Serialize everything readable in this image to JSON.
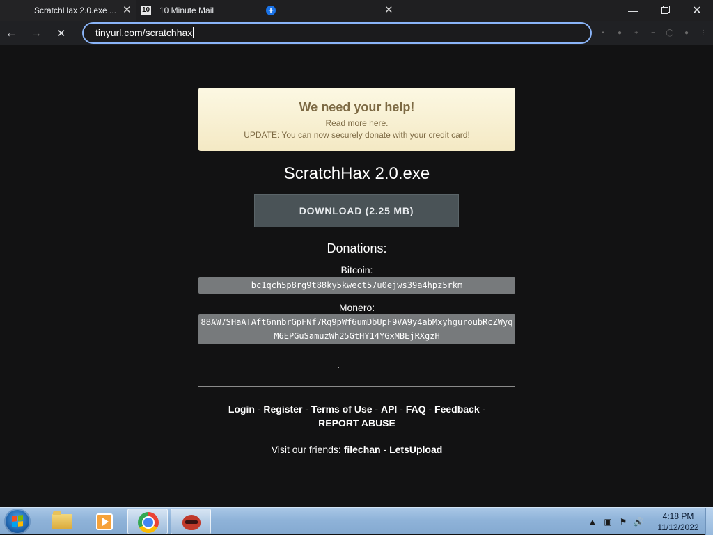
{
  "browser": {
    "tabs": [
      {
        "title": "ScratchHax 2.0.exe ...",
        "close": "✕",
        "active": true
      },
      {
        "title": "10 Minute Mail",
        "favicon_text": "10",
        "close": "✕",
        "active": false
      }
    ],
    "new_tab": "+",
    "window_controls": {
      "minimize": "—",
      "close": "✕"
    },
    "nav": {
      "back": "←",
      "forward": "→",
      "stop": "✕"
    },
    "address": "tinyurl.com/scratchhax",
    "toolbar_icons": [
      "▪",
      "●",
      "+",
      "−",
      "◯",
      "●",
      "⋮"
    ]
  },
  "page": {
    "notice": {
      "title": "We need your help!",
      "line1": "Read more here.",
      "line2": "UPDATE: You can now securely donate with your credit card!"
    },
    "file_name": "ScratchHax 2.0.exe",
    "download_label": "DOWNLOAD (2.25 MB)",
    "donations_title": "Donations:",
    "bitcoin_label": "Bitcoin:",
    "bitcoin_address": "bc1qch5p8rg9t88ky5kwect57u0ejws39a4hpz5rkm",
    "monero_label": "Monero:",
    "monero_address": "88AW7SHaATAft6nnbrGpFNf7Rq9pWf6umDbUpF9VA9y4abMxyhguroubRcZWyqM6EPGuSamuzWh25GtHY14YGxMBEjRXgzH",
    "dot": ".",
    "footer": {
      "login": "Login",
      "register": "Register",
      "terms": "Terms of Use",
      "api": "API",
      "faq": "FAQ",
      "feedback": "Feedback",
      "report": "REPORT ABUSE",
      "sep": " - ",
      "friends_prefix": "Visit our friends: ",
      "friend1": "filechan",
      "friend2": "LetsUpload"
    }
  },
  "taskbar": {
    "tray_icons": [
      "▲",
      "▣",
      "⚑",
      "🔊"
    ],
    "time": "4:18 PM",
    "date": "11/12/2022"
  }
}
